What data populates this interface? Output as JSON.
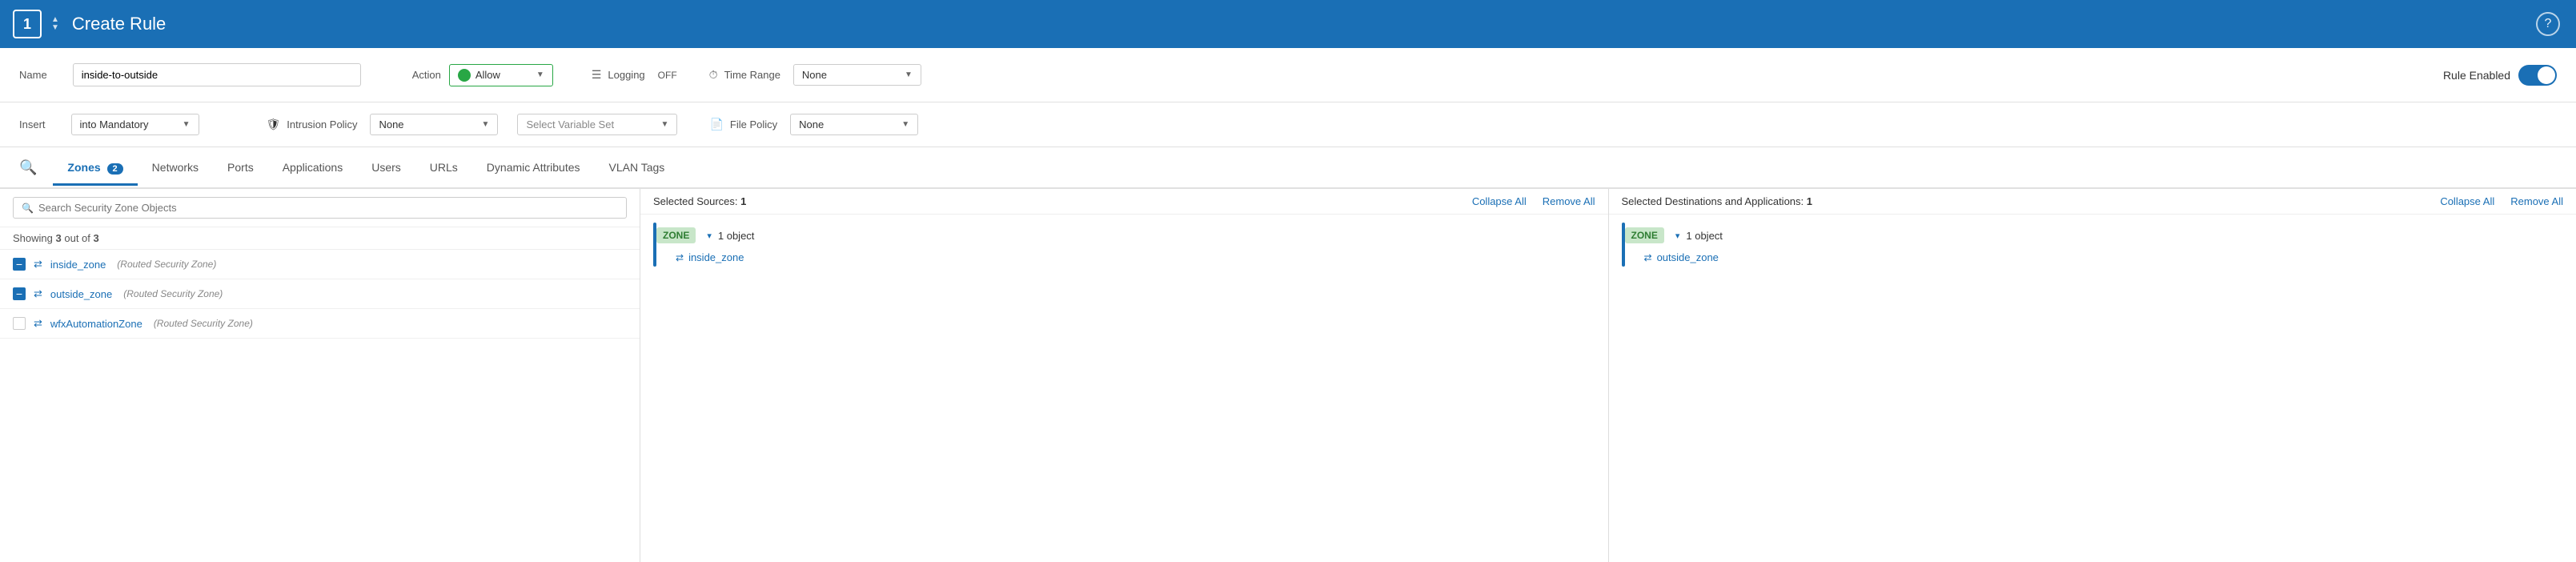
{
  "header": {
    "step": "1",
    "title": "Create Rule",
    "help_icon": "?"
  },
  "form": {
    "name_label": "Name",
    "name_value": "inside-to-outside",
    "insert_label": "Insert",
    "insert_value": "into Mandatory",
    "action_label": "Action",
    "action_value": "Allow",
    "logging_label": "Logging",
    "logging_value": "OFF",
    "time_range_label": "Time Range",
    "time_range_value": "None",
    "rule_enabled_label": "Rule Enabled",
    "intrusion_policy_label": "Intrusion Policy",
    "intrusion_policy_value": "None",
    "variable_set_placeholder": "Select Variable Set",
    "file_policy_label": "File Policy",
    "file_policy_value": "None"
  },
  "tabs": [
    {
      "label": "Zones",
      "badge": "2",
      "active": true
    },
    {
      "label": "Networks",
      "badge": null,
      "active": false
    },
    {
      "label": "Ports",
      "badge": null,
      "active": false
    },
    {
      "label": "Applications",
      "badge": null,
      "active": false
    },
    {
      "label": "Users",
      "badge": null,
      "active": false
    },
    {
      "label": "URLs",
      "badge": null,
      "active": false
    },
    {
      "label": "Dynamic Attributes",
      "badge": null,
      "active": false
    },
    {
      "label": "VLAN Tags",
      "badge": null,
      "active": false
    }
  ],
  "search": {
    "placeholder": "Search Security Zone Objects"
  },
  "showing_text": "Showing",
  "showing_count": "3",
  "showing_out_of": "out of",
  "showing_total": "3",
  "zones": [
    {
      "name": "inside_zone",
      "type": "(Routed Security Zone)",
      "checked": "minus"
    },
    {
      "name": "outside_zone",
      "type": "(Routed Security Zone)",
      "checked": "minus"
    },
    {
      "name": "wfxAutomationZone",
      "type": "(Routed Security Zone)",
      "checked": "none"
    }
  ],
  "sources": {
    "title": "Selected Sources:",
    "count": "1",
    "collapse_label": "Collapse All",
    "remove_label": "Remove All",
    "zone_tag": "ZONE",
    "object_count_label": "1 object",
    "object_name": "inside_zone"
  },
  "destinations": {
    "title": "Selected Destinations and Applications:",
    "count": "1",
    "collapse_label": "Collapse All",
    "remove_label": "Remove All",
    "zone_tag": "ZONE",
    "object_count_label": "1 object",
    "object_name": "outside_zone"
  }
}
